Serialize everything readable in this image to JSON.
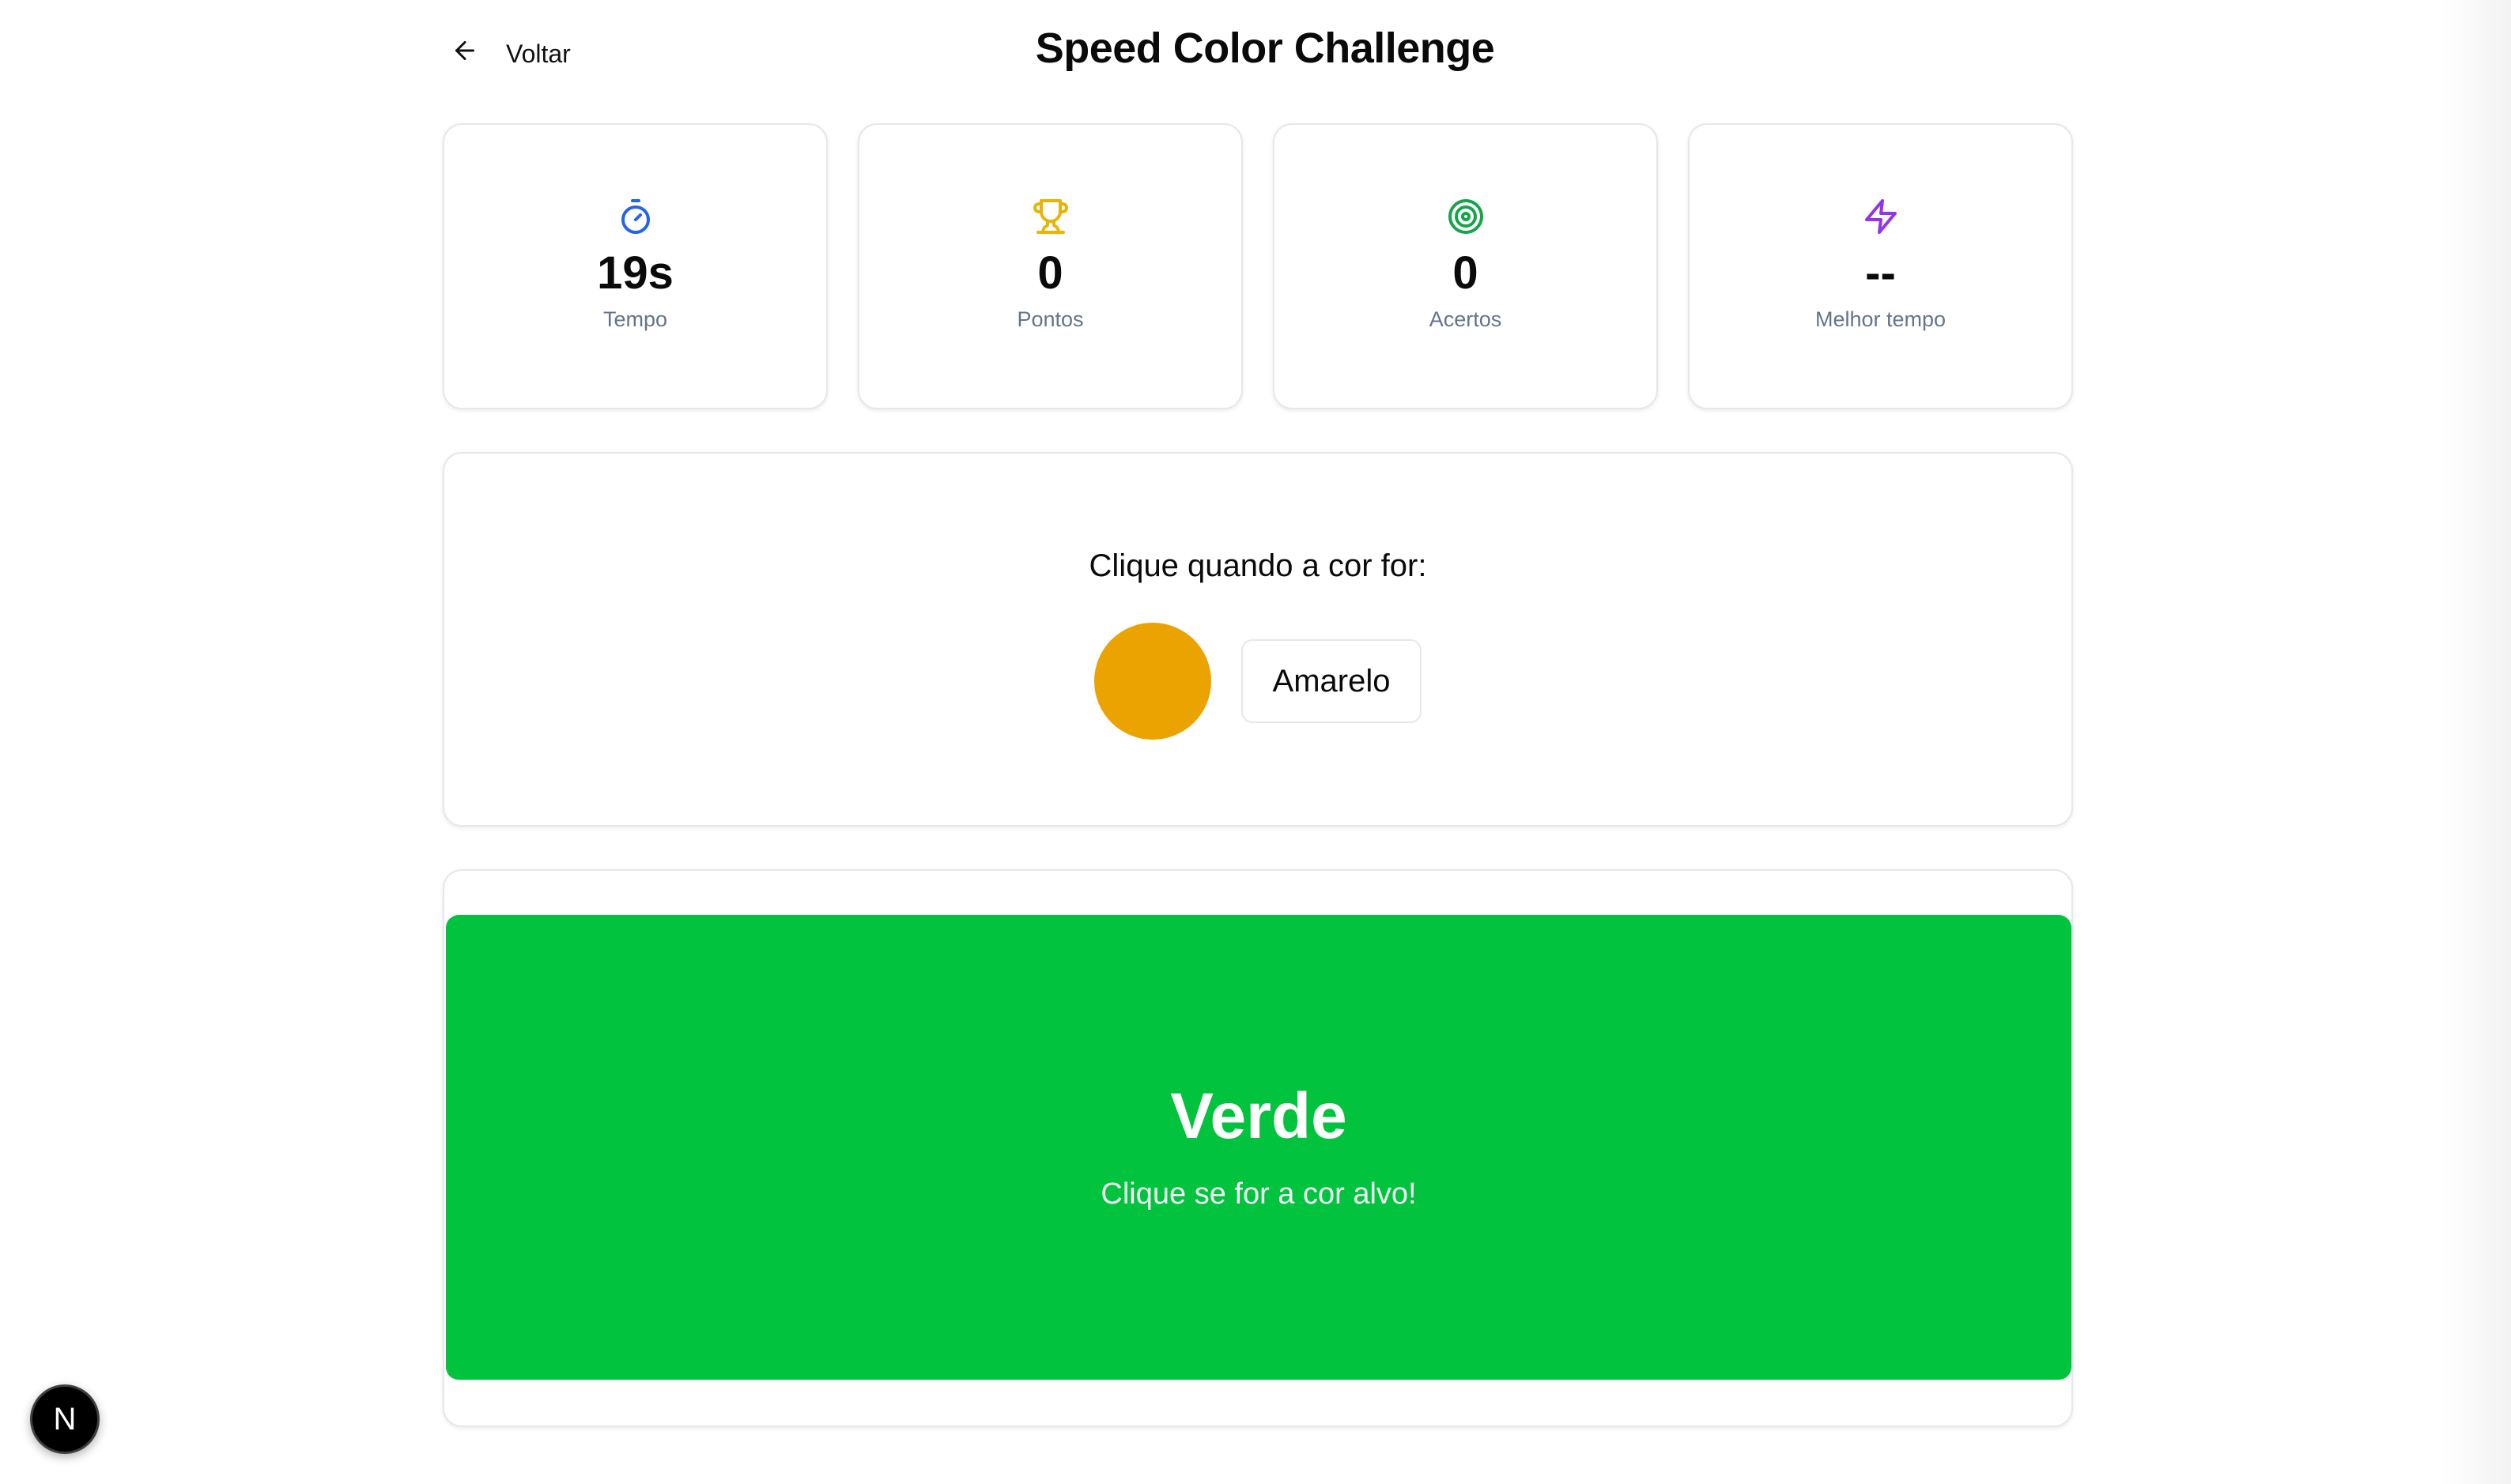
{
  "header": {
    "back_label": "Voltar",
    "title": "Speed Color Challenge"
  },
  "stats": [
    {
      "icon": "timer-icon",
      "value": "19s",
      "label": "Tempo",
      "color": "#2563eb"
    },
    {
      "icon": "trophy-icon",
      "value": "0",
      "label": "Pontos",
      "color": "#eab308"
    },
    {
      "icon": "target-icon",
      "value": "0",
      "label": "Acertos",
      "color": "#16a34a"
    },
    {
      "icon": "zap-icon",
      "value": "--",
      "label": "Melhor tempo",
      "color": "#9333ea"
    }
  ],
  "target": {
    "prompt": "Clique quando a cor for:",
    "color_name": "Amarelo",
    "color_hex": "#eaa300"
  },
  "play": {
    "color_word": "Verde",
    "hint": "Clique se for a cor alvo!",
    "background": "#02c33e"
  },
  "badge": {
    "label": "N"
  }
}
